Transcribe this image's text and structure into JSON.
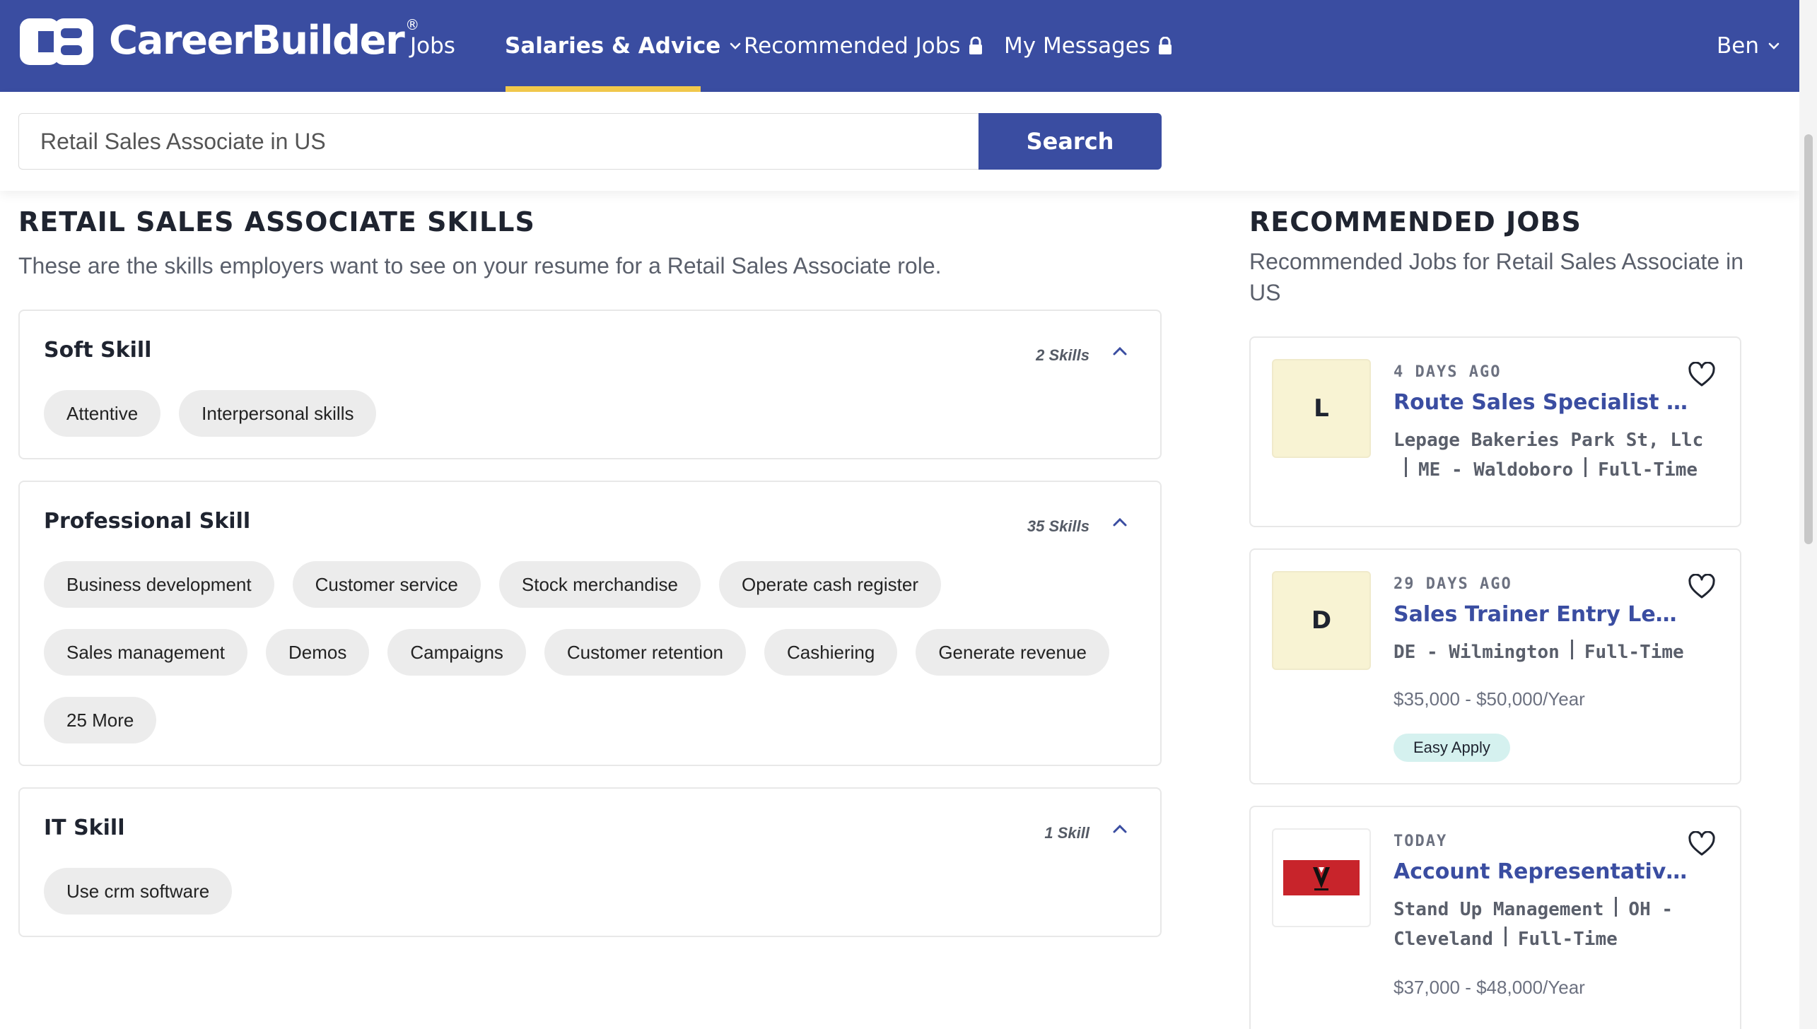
{
  "brand": {
    "name": "CareerBuilder",
    "reg": "®"
  },
  "nav": {
    "jobs": "Jobs",
    "salaries": "Salaries & Advice",
    "recommended": "Recommended Jobs",
    "messages": "My Messages",
    "user": "Ben",
    "accent": "#3a4da1",
    "underline_color": "#f2c94c"
  },
  "search": {
    "value": "Retail Sales Associate in US",
    "button": "Search"
  },
  "skills_section": {
    "title": "RETAIL SALES ASSOCIATE SKILLS",
    "subtitle": "These are the skills employers want to see on your resume for a Retail Sales Associate role.",
    "groups": [
      {
        "title": "Soft Skill",
        "count": "2 Skills",
        "chips": [
          "Attentive",
          "Interpersonal skills"
        ]
      },
      {
        "title": "Professional Skill",
        "count": "35 Skills",
        "chips": [
          "Business development",
          "Customer service",
          "Stock merchandise",
          "Operate cash register",
          "Sales management",
          "Demos",
          "Campaigns",
          "Customer retention",
          "Cashiering",
          "Generate revenue",
          "25 More"
        ]
      },
      {
        "title": "IT Skill",
        "count": "1 Skill",
        "chips": [
          "Use crm software"
        ]
      }
    ]
  },
  "recommended": {
    "title": "RECOMMENDED JOBS",
    "subtitle": "Recommended Jobs for Retail Sales Associate in US",
    "jobs": [
      {
        "logo": "L",
        "date": "4 DAYS AGO",
        "title": "Route Sales Specialist Ii W...",
        "company": "Lepage Bakeries Park St, Llc",
        "location": "ME - Waldoboro",
        "type": "Full-Time"
      },
      {
        "logo": "D",
        "date": "29 DAYS AGO",
        "title": "Sales Trainer Entry Level +...",
        "location": "DE - Wilmington",
        "type": "Full-Time",
        "salary": "$35,000 - $50,000/Year",
        "badge": "Easy Apply"
      },
      {
        "logo_icon": "stand-up-management-logo",
        "date": "TODAY",
        "title": "Account Representative ( I...",
        "company": "Stand Up Management",
        "location": "OH - Cleveland",
        "type": "Full-Time",
        "salary": "$37,000 - $48,000/Year"
      }
    ]
  }
}
